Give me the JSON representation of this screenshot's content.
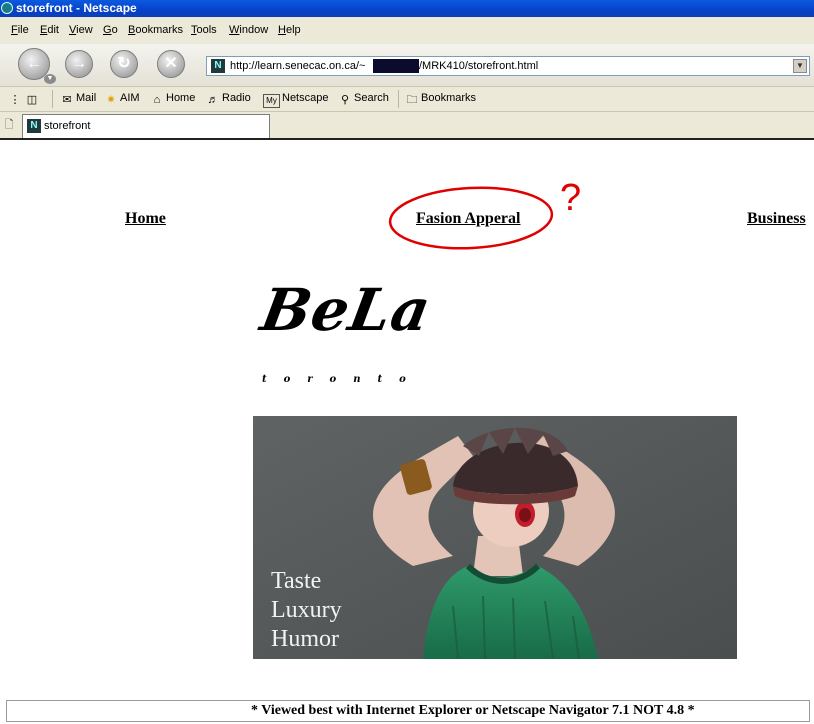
{
  "window": {
    "title": "storefront - Netscape"
  },
  "menu": {
    "items": [
      "File",
      "Edit",
      "View",
      "Go",
      "Bookmarks",
      "Tools",
      "Window",
      "Help"
    ]
  },
  "address": {
    "url_prefix": "http://learn.senecac.on.ca/~",
    "url_suffix": "/MRK410/storefront.html"
  },
  "personal_toolbar": {
    "items": [
      "Mail",
      "AIM",
      "Home",
      "Radio",
      "Netscape",
      "Search",
      "Bookmarks"
    ]
  },
  "tab": {
    "label": "storefront"
  },
  "page": {
    "nav": {
      "home": "Home",
      "fashion": "Fasion Apperal",
      "business": "Business"
    },
    "annotation": {
      "mark": "?",
      "color": "#e00000"
    },
    "logo": "BeLa",
    "tagline": "toronto",
    "hero": {
      "lines": [
        "Taste",
        "Luxury",
        "Humor"
      ]
    },
    "footer": "* Viewed best with Internet Explorer or Netscape Navigator 7.1 NOT 4.8 *"
  }
}
